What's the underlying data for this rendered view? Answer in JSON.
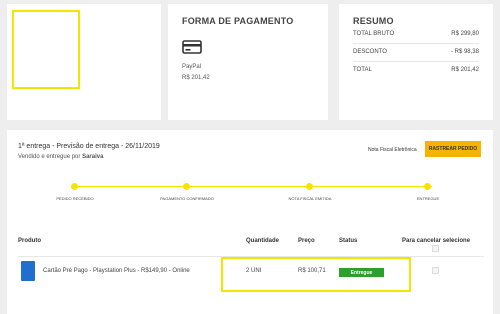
{
  "colors": {
    "highlight": "#f2e600",
    "track_button": "#f5b400",
    "status_delivered": "#2ca02c",
    "background": "#eeeeee"
  },
  "payment": {
    "title": "FORMA DE PAGAMENTO",
    "icon": "credit-card-icon",
    "method": "PayPal",
    "amount": "R$ 201,42"
  },
  "summary": {
    "title": "RESUMO",
    "rows": [
      {
        "label": "TOTAL BRUTO",
        "value": "R$ 299,80"
      },
      {
        "label": "DESCONTO",
        "value": "- R$ 98,38"
      },
      {
        "label": "TOTAL",
        "value": "R$ 201,42"
      }
    ]
  },
  "order": {
    "title": "1ª entrega - Previsão de entrega - 26/11/2019",
    "seller_prefix": "Vendido e entregue por ",
    "seller": "Saraiva",
    "invoice_link": "Nota Fiscal Eletrônica",
    "track_button": "RASTREAR PEDIDO",
    "steps": [
      "PEDIDO RECEBIDO",
      "PAGAMENTO CONFIRMADO",
      "NOTA FISCAL EMITIDA",
      "ENTREGUE"
    ],
    "table": {
      "headers": {
        "product": "Produto",
        "quantity": "Quantidade",
        "price": "Preço",
        "status": "Status",
        "cancel": "Para cancelar selecione"
      },
      "rows": [
        {
          "product": "Cartão Pré Pago - Playstation Plus - R$149,90 - Online",
          "quantity": "2 UNI",
          "price": "R$ 100,71",
          "status": "Entregue"
        }
      ]
    }
  }
}
